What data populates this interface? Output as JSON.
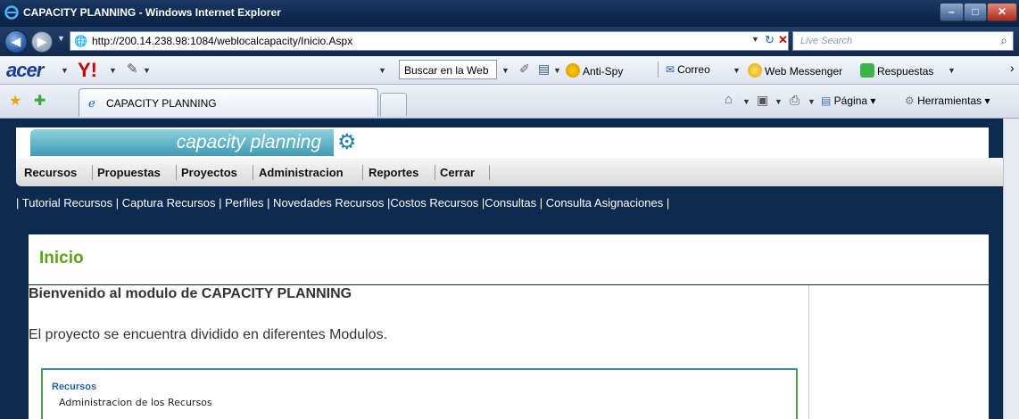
{
  "window": {
    "title": "CAPACITY PLANNING - Windows Internet Explorer"
  },
  "address_bar": {
    "url": "http://200.14.238.98:1084/weblocalcapacity/Inicio.Aspx",
    "search_placeholder": "Live Search"
  },
  "toolbar": {
    "brand": "acer",
    "yahoo": "Y!",
    "buscar": "Buscar en la Web",
    "antispy": "Anti-Spy",
    "correo": "Correo",
    "messenger": "Web Messenger",
    "respuestas": "Respuestas"
  },
  "tabs": {
    "active_label": "CAPACITY PLANNING"
  },
  "commands": {
    "pagina": "Página",
    "herramientas": "Herramientas"
  },
  "site": {
    "logo_text": "capacity planning",
    "menu": [
      "Recursos",
      "Propuestas",
      "Proyectos",
      "Administracion",
      "Reportes",
      "Cerrar"
    ],
    "submenu": "| Tutorial Recursos | Captura Recursos | Perfiles | Novedades Recursos |Costos Recursos |Consultas | Consulta Asignaciones |",
    "heading": "Inicio",
    "welcome": "Bienvenido al modulo de CAPACITY PLANNING",
    "intro": "El proyecto se encuentra dividido en diferentes Modulos.",
    "module_title": "Recursos",
    "module_desc": "Administracion de los Recursos"
  },
  "colors": {
    "page_background": "#0f2a4f",
    "heading_green": "#5aa516",
    "link_blue": "#2265a3"
  }
}
